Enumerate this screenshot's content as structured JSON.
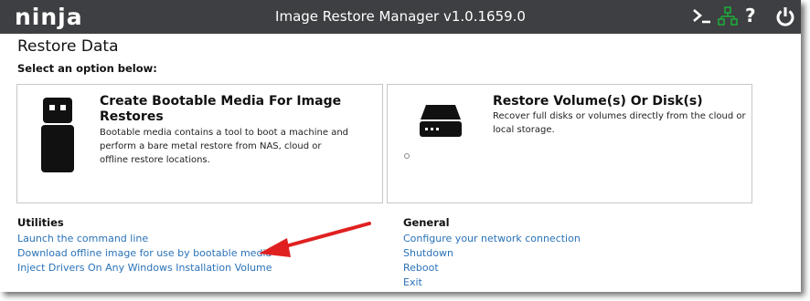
{
  "app": {
    "logo": "ninja",
    "title": "Image Restore Manager v1.0.1659.0"
  },
  "toolbar": {
    "terminal_icon": "terminal-icon",
    "network_icon": "network-icon",
    "help_label": "?",
    "power_icon": "power-icon",
    "network_color": "#1fa83a"
  },
  "page": {
    "title": "Restore Data",
    "subtitle": "Select an option below:"
  },
  "cards": [
    {
      "title_line1": "Create Bootable Media For Image",
      "title_line2": "Restores",
      "desc_line1": "Bootable media contains a tool to boot a machine and",
      "desc_line2": "perform a bare metal restore from NAS, cloud or",
      "desc_line3": "offline restore locations.",
      "icon": "usb-drive-icon"
    },
    {
      "title": "Restore Volume(s) Or Disk(s)",
      "desc_line1": "Recover full disks or volumes directly from the cloud or",
      "desc_line2": "local storage.",
      "icon": "hard-drive-icon"
    }
  ],
  "utilities": {
    "heading": "Utilities",
    "links": [
      "Launch the command line",
      "Download offline image for use by bootable media",
      "Inject Drivers On Any Windows Installation Volume"
    ]
  },
  "general": {
    "heading": "General",
    "links": [
      "Configure your network connection",
      "Shutdown",
      "Reboot",
      "Exit"
    ]
  },
  "colors": {
    "titlebar": "#3e3f42",
    "link": "#2a72b8",
    "annotation_arrow": "#e02020"
  }
}
